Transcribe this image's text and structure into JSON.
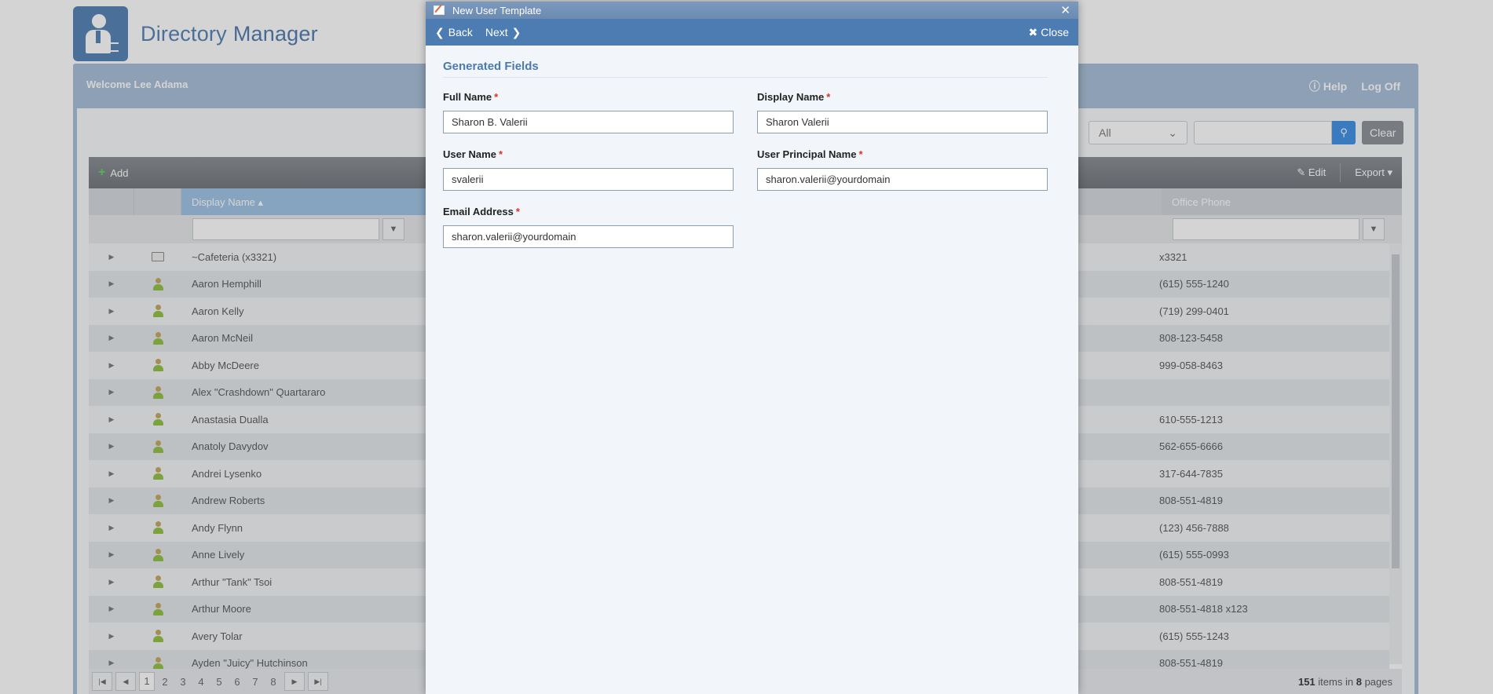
{
  "app": {
    "title_part1": "Directory",
    "title_part2": "Manager",
    "welcome": "Welcome Lee Adama",
    "help": "Help",
    "logoff": "Log Off"
  },
  "filter": {
    "scope": "All",
    "clear": "Clear"
  },
  "grid": {
    "add": "Add",
    "edit": "Edit",
    "export": "Export",
    "col_display_name": "Display Name",
    "col_office_phone": "Office Phone",
    "rows": [
      {
        "name": "~Cafeteria (x3321)",
        "phone": "x3321",
        "type": "contact"
      },
      {
        "name": "Aaron Hemphill",
        "phone": "(615) 555-1240",
        "type": "user"
      },
      {
        "name": "Aaron Kelly",
        "phone": "(719) 299-0401",
        "type": "user"
      },
      {
        "name": "Aaron McNeil",
        "phone": "808-123-5458",
        "type": "user"
      },
      {
        "name": "Abby McDeere",
        "phone": "999-058-8463",
        "type": "user"
      },
      {
        "name": "Alex \"Crashdown\" Quartararo",
        "phone": "",
        "type": "user"
      },
      {
        "name": "Anastasia Dualla",
        "phone": "610-555-1213",
        "type": "user"
      },
      {
        "name": "Anatoly Davydov",
        "phone": "562-655-6666",
        "type": "user"
      },
      {
        "name": "Andrei Lysenko",
        "phone": "317-644-7835",
        "type": "user"
      },
      {
        "name": "Andrew Roberts",
        "phone": "808-551-4819",
        "type": "user"
      },
      {
        "name": "Andy Flynn",
        "phone": "(123) 456-7888",
        "type": "user"
      },
      {
        "name": "Anne Lively",
        "phone": "(615) 555-0993",
        "type": "user"
      },
      {
        "name": "Arthur \"Tank\" Tsoi",
        "phone": "808-551-4819",
        "type": "user"
      },
      {
        "name": "Arthur Moore",
        "phone": "808-551-4818 x123",
        "type": "user"
      },
      {
        "name": "Avery Tolar",
        "phone": "(615) 555-1243",
        "type": "user"
      },
      {
        "name": "Ayden \"Juicy\" Hutchinson",
        "phone": "808-551-4819",
        "type": "user"
      }
    ],
    "pages": [
      "1",
      "2",
      "3",
      "4",
      "5",
      "6",
      "7",
      "8"
    ],
    "items_count": "151",
    "items_in": "items in",
    "pages_count": "8",
    "pages_label": "pages"
  },
  "modal": {
    "title": "New User Template",
    "back": "Back",
    "next": "Next",
    "close": "Close",
    "section_title": "Generated Fields",
    "fields": {
      "full_name": {
        "label": "Full Name",
        "value": "Sharon B. Valerii"
      },
      "display_name": {
        "label": "Display Name",
        "value": "Sharon Valerii"
      },
      "user_name": {
        "label": "User Name",
        "value": "svalerii"
      },
      "upn": {
        "label": "User Principal Name",
        "value": "sharon.valerii@yourdomain"
      },
      "email": {
        "label": "Email Address",
        "value": "sharon.valerii@yourdomain"
      }
    },
    "required_mark": "*"
  }
}
